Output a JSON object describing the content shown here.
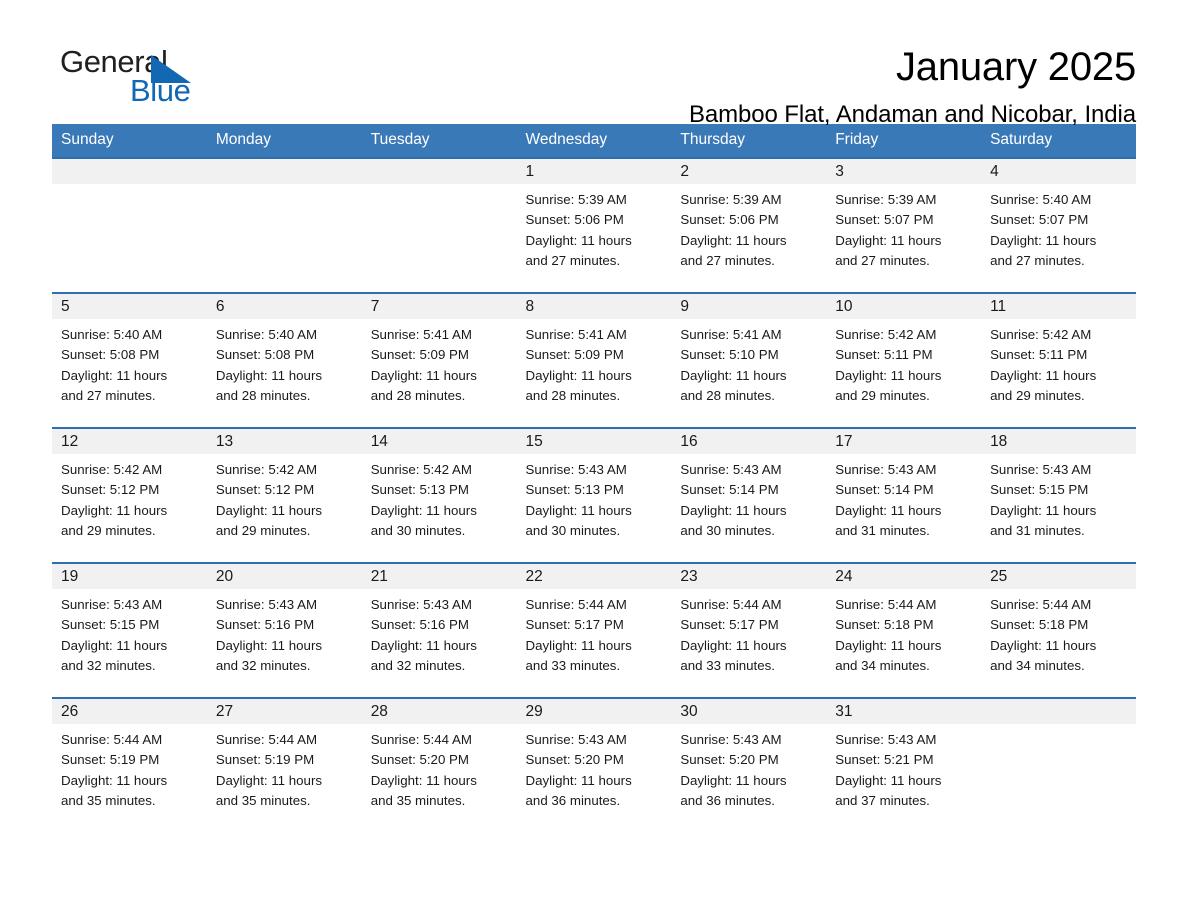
{
  "brand": {
    "name_part1": "General",
    "name_part2": "Blue",
    "accent_color": "#1268b3"
  },
  "header": {
    "month_title": "January 2025",
    "location": "Bamboo Flat, Andaman and Nicobar, India"
  },
  "theme": {
    "header_row_color": "#3a79b8",
    "row_divider_color": "#2f6fb0",
    "daynum_band_color": "#f1f1f1"
  },
  "calendar": {
    "weekday_headers": [
      "Sunday",
      "Monday",
      "Tuesday",
      "Wednesday",
      "Thursday",
      "Friday",
      "Saturday"
    ],
    "weeks": [
      [
        {
          "day": "",
          "details": ""
        },
        {
          "day": "",
          "details": ""
        },
        {
          "day": "",
          "details": ""
        },
        {
          "day": "1",
          "details": "Sunrise: 5:39 AM\nSunset: 5:06 PM\nDaylight: 11 hours\nand 27 minutes."
        },
        {
          "day": "2",
          "details": "Sunrise: 5:39 AM\nSunset: 5:06 PM\nDaylight: 11 hours\nand 27 minutes."
        },
        {
          "day": "3",
          "details": "Sunrise: 5:39 AM\nSunset: 5:07 PM\nDaylight: 11 hours\nand 27 minutes."
        },
        {
          "day": "4",
          "details": "Sunrise: 5:40 AM\nSunset: 5:07 PM\nDaylight: 11 hours\nand 27 minutes."
        }
      ],
      [
        {
          "day": "5",
          "details": "Sunrise: 5:40 AM\nSunset: 5:08 PM\nDaylight: 11 hours\nand 27 minutes."
        },
        {
          "day": "6",
          "details": "Sunrise: 5:40 AM\nSunset: 5:08 PM\nDaylight: 11 hours\nand 28 minutes."
        },
        {
          "day": "7",
          "details": "Sunrise: 5:41 AM\nSunset: 5:09 PM\nDaylight: 11 hours\nand 28 minutes."
        },
        {
          "day": "8",
          "details": "Sunrise: 5:41 AM\nSunset: 5:09 PM\nDaylight: 11 hours\nand 28 minutes."
        },
        {
          "day": "9",
          "details": "Sunrise: 5:41 AM\nSunset: 5:10 PM\nDaylight: 11 hours\nand 28 minutes."
        },
        {
          "day": "10",
          "details": "Sunrise: 5:42 AM\nSunset: 5:11 PM\nDaylight: 11 hours\nand 29 minutes."
        },
        {
          "day": "11",
          "details": "Sunrise: 5:42 AM\nSunset: 5:11 PM\nDaylight: 11 hours\nand 29 minutes."
        }
      ],
      [
        {
          "day": "12",
          "details": "Sunrise: 5:42 AM\nSunset: 5:12 PM\nDaylight: 11 hours\nand 29 minutes."
        },
        {
          "day": "13",
          "details": "Sunrise: 5:42 AM\nSunset: 5:12 PM\nDaylight: 11 hours\nand 29 minutes."
        },
        {
          "day": "14",
          "details": "Sunrise: 5:42 AM\nSunset: 5:13 PM\nDaylight: 11 hours\nand 30 minutes."
        },
        {
          "day": "15",
          "details": "Sunrise: 5:43 AM\nSunset: 5:13 PM\nDaylight: 11 hours\nand 30 minutes."
        },
        {
          "day": "16",
          "details": "Sunrise: 5:43 AM\nSunset: 5:14 PM\nDaylight: 11 hours\nand 30 minutes."
        },
        {
          "day": "17",
          "details": "Sunrise: 5:43 AM\nSunset: 5:14 PM\nDaylight: 11 hours\nand 31 minutes."
        },
        {
          "day": "18",
          "details": "Sunrise: 5:43 AM\nSunset: 5:15 PM\nDaylight: 11 hours\nand 31 minutes."
        }
      ],
      [
        {
          "day": "19",
          "details": "Sunrise: 5:43 AM\nSunset: 5:15 PM\nDaylight: 11 hours\nand 32 minutes."
        },
        {
          "day": "20",
          "details": "Sunrise: 5:43 AM\nSunset: 5:16 PM\nDaylight: 11 hours\nand 32 minutes."
        },
        {
          "day": "21",
          "details": "Sunrise: 5:43 AM\nSunset: 5:16 PM\nDaylight: 11 hours\nand 32 minutes."
        },
        {
          "day": "22",
          "details": "Sunrise: 5:44 AM\nSunset: 5:17 PM\nDaylight: 11 hours\nand 33 minutes."
        },
        {
          "day": "23",
          "details": "Sunrise: 5:44 AM\nSunset: 5:17 PM\nDaylight: 11 hours\nand 33 minutes."
        },
        {
          "day": "24",
          "details": "Sunrise: 5:44 AM\nSunset: 5:18 PM\nDaylight: 11 hours\nand 34 minutes."
        },
        {
          "day": "25",
          "details": "Sunrise: 5:44 AM\nSunset: 5:18 PM\nDaylight: 11 hours\nand 34 minutes."
        }
      ],
      [
        {
          "day": "26",
          "details": "Sunrise: 5:44 AM\nSunset: 5:19 PM\nDaylight: 11 hours\nand 35 minutes."
        },
        {
          "day": "27",
          "details": "Sunrise: 5:44 AM\nSunset: 5:19 PM\nDaylight: 11 hours\nand 35 minutes."
        },
        {
          "day": "28",
          "details": "Sunrise: 5:44 AM\nSunset: 5:20 PM\nDaylight: 11 hours\nand 35 minutes."
        },
        {
          "day": "29",
          "details": "Sunrise: 5:43 AM\nSunset: 5:20 PM\nDaylight: 11 hours\nand 36 minutes."
        },
        {
          "day": "30",
          "details": "Sunrise: 5:43 AM\nSunset: 5:20 PM\nDaylight: 11 hours\nand 36 minutes."
        },
        {
          "day": "31",
          "details": "Sunrise: 5:43 AM\nSunset: 5:21 PM\nDaylight: 11 hours\nand 37 minutes."
        },
        {
          "day": "",
          "details": ""
        }
      ]
    ]
  }
}
